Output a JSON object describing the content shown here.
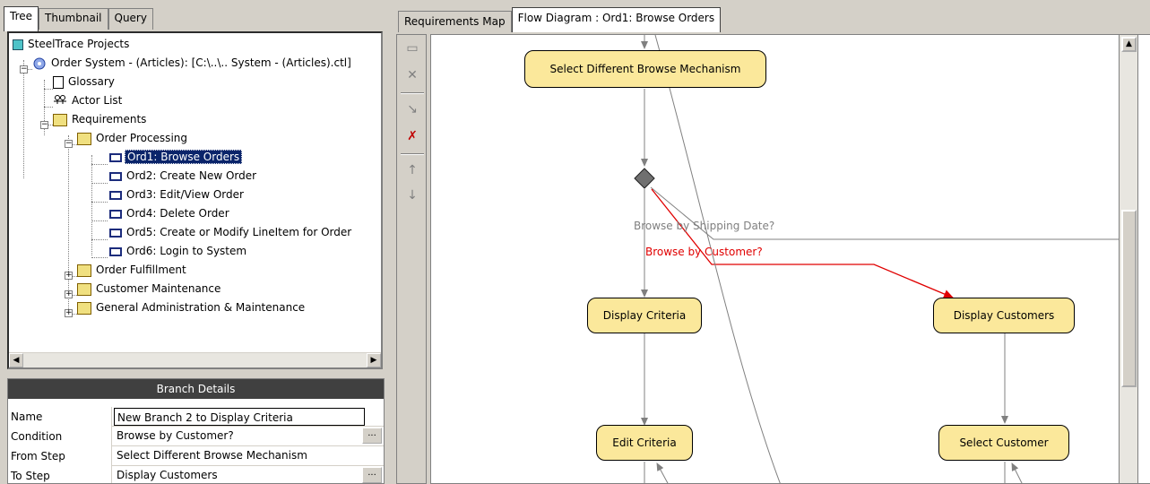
{
  "left_tabs": [
    {
      "label": "Tree",
      "active": true
    },
    {
      "label": "Thumbnail",
      "active": false
    },
    {
      "label": "Query",
      "active": false
    }
  ],
  "tree": {
    "root": "SteelTrace Projects",
    "project": "Order System - (Articles): [C:\\..\\.. System - (Articles).ctl]",
    "glossary": "Glossary",
    "actor_list": "Actor List",
    "requirements": "Requirements",
    "order_processing": "Order Processing",
    "items": [
      "Ord1: Browse Orders",
      "Ord2: Create New Order",
      "Ord3: Edit/View Order",
      "Ord4: Delete Order",
      "Ord5: Create or Modify LineItem for Order",
      "Ord6: Login to System"
    ],
    "selected_item": "Ord1: Browse Orders",
    "folders": [
      "Order Fulfillment",
      "Customer Maintenance",
      "General Administration & Maintenance"
    ]
  },
  "branch_details": {
    "title": "Branch Details",
    "rows": [
      {
        "name": "Name",
        "value": "New Branch 2 to Display Criteria"
      },
      {
        "name": "Condition",
        "value": "Browse by Customer?"
      },
      {
        "name": "From Step",
        "value": "Select Different Browse Mechanism"
      },
      {
        "name": "To Step",
        "value": "Display Customers"
      }
    ],
    "ellipsis": "..."
  },
  "right_tabs": [
    {
      "label": "Requirements Map",
      "active": false
    },
    {
      "label": "Flow Diagram : Ord1: Browse Orders",
      "active": true
    }
  ],
  "diagram": {
    "nodes": {
      "select_browse": "Select Different Browse Mechanism",
      "display_criteria": "Display Criteria",
      "display_customers": "Display Customers",
      "edit_criteria": "Edit Criteria",
      "select_customer": "Select Customer"
    },
    "labels": {
      "shipping": "Browse by Shipping Date?",
      "customer": "Browse by Customer?"
    }
  },
  "colors": {
    "node_fill": "#fbe89b",
    "selection": "#0a246a",
    "highlight_edge": "#e00000"
  }
}
